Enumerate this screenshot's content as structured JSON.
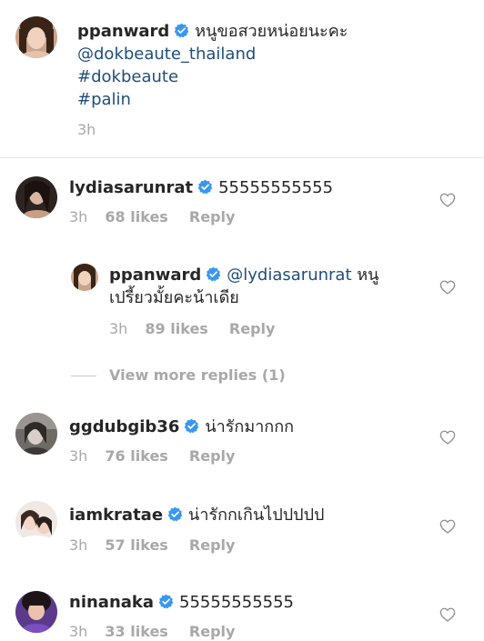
{
  "post": {
    "username": "ppanward",
    "caption_text": "หนูขอสวยหน่อยนะคะ",
    "caption_mention": "@dokbeaute_thailand",
    "hashtags": [
      "#dokbeaute",
      "#palin"
    ],
    "time": "3h"
  },
  "comments": [
    {
      "username": "lydiasarunrat",
      "text": "55555555555",
      "time": "3h",
      "likes": "68 likes",
      "reply": "Reply"
    },
    {
      "username": "ggdubgib36",
      "text": "น่ารักมากกก",
      "time": "3h",
      "likes": "76 likes",
      "reply": "Reply"
    },
    {
      "username": "iamkratae",
      "text": "น่ารักกเกินไปปปปป",
      "time": "3h",
      "likes": "57 likes",
      "reply": "Reply"
    },
    {
      "username": "ninanaka",
      "text": "55555555555",
      "time": "3h",
      "likes": "33 likes",
      "reply": "Reply"
    }
  ],
  "reply": {
    "username": "ppanward",
    "mention": "@lydiasarunrat",
    "text_line1": "หนู",
    "text_line2": "เปรี้ยวมั้ยคะน้าเดีย",
    "time": "3h",
    "likes": "89 likes",
    "reply": "Reply"
  },
  "view_more_replies": "View more replies (1)",
  "colors": {
    "verified": "#3897f0",
    "link": "#1e4e7c",
    "meta": "#a8a8a8"
  },
  "icons": {
    "verified": "verified-badge-icon",
    "heart": "heart-outline-icon"
  }
}
